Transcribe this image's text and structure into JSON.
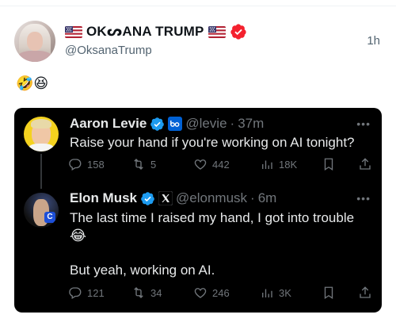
{
  "post": {
    "display_name": "OKᔕANA TRUMP",
    "handle": "@OksanaTrump",
    "time_ago": "1h",
    "text": "🤣😆"
  },
  "quote": {
    "first": {
      "name": "Aaron Levie",
      "handle": "@levie",
      "separator": "·",
      "time": "37m",
      "more": "•••",
      "text": "Raise your hand if you're working on AI tonight?",
      "stats": {
        "replies": "158",
        "reposts": "5",
        "likes": "442",
        "views": "18K"
      }
    },
    "second": {
      "name": "Elon Musk",
      "handle": "@elonmusk",
      "separator": "·",
      "time": "6m",
      "more": "•••",
      "text_line1": "The last time I raised my hand, I got into trouble",
      "emoji": "😂",
      "text_line2": "But yeah, working on AI.",
      "stats": {
        "replies": "121",
        "reposts": "34",
        "likes": "246",
        "views": "3K"
      }
    }
  },
  "colors": {
    "verified_blue": "#1d9bf0",
    "verified_red": "#f4212e",
    "card_bg": "#000000",
    "muted_text": "#71767b"
  },
  "icons": [
    "us-flag-icon",
    "verified-badge-icon",
    "box-logo-icon",
    "x-logo-icon",
    "reply-icon",
    "repost-icon",
    "like-icon",
    "views-icon",
    "bookmark-icon",
    "share-icon",
    "more-icon"
  ]
}
